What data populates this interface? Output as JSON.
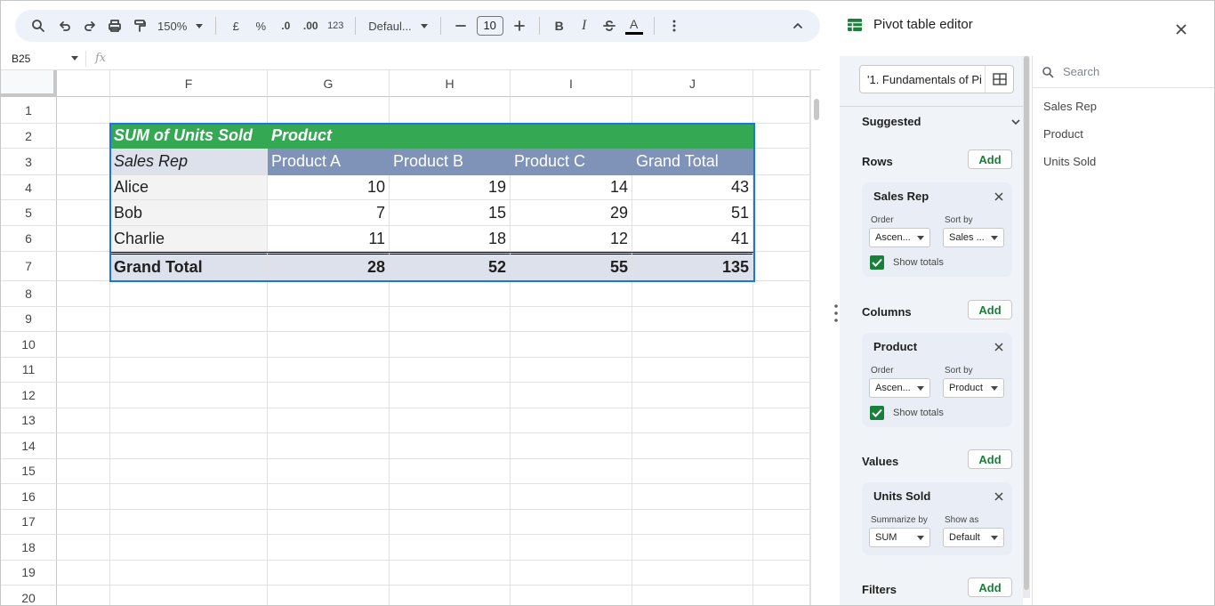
{
  "toolbar": {
    "zoom": "150%",
    "currency": "£",
    "percent": "%",
    "decrease_decimal": ".0",
    "increase_decimal": ".00",
    "number_format": "123",
    "font": "Defaul...",
    "font_size": "10",
    "bold": "B",
    "italic": "I",
    "text_color": "A"
  },
  "formula_bar": {
    "cell_ref": "B25",
    "fx": "fx",
    "value": ""
  },
  "columns": [
    "F",
    "G",
    "H",
    "I",
    "J"
  ],
  "rows": [
    "1",
    "2",
    "3",
    "4",
    "5",
    "6",
    "7",
    "8",
    "9",
    "10",
    "11",
    "12",
    "13",
    "14",
    "15",
    "16",
    "17",
    "18",
    "19",
    "20"
  ],
  "pivot": {
    "corner_label": "SUM of Units Sold",
    "column_group_label": "Product",
    "row_header": "Sales Rep",
    "column_headers": [
      "Product A",
      "Product B",
      "Product C",
      "Grand Total"
    ],
    "rows": [
      {
        "label": "Alice",
        "values": [
          "10",
          "19",
          "14",
          "43"
        ]
      },
      {
        "label": "Bob",
        "values": [
          "7",
          "15",
          "29",
          "51"
        ]
      },
      {
        "label": "Charlie",
        "values": [
          "11",
          "18",
          "12",
          "41"
        ]
      }
    ],
    "grand_total": {
      "label": "Grand Total",
      "values": [
        "28",
        "52",
        "55",
        "135"
      ]
    }
  },
  "editor": {
    "title": "Pivot table editor",
    "range": "'1. Fundamentals of Pi",
    "suggested": "Suggested",
    "add_label": "Add",
    "rows_section": "Rows",
    "columns_section": "Columns",
    "values_section": "Values",
    "filters_section": "Filters",
    "row_card": {
      "title": "Sales Rep",
      "order_label": "Order",
      "order_value": "Ascen...",
      "sort_label": "Sort by",
      "sort_value": "Sales ...",
      "show_totals": "Show totals"
    },
    "column_card": {
      "title": "Product",
      "order_label": "Order",
      "order_value": "Ascen...",
      "sort_label": "Sort by",
      "sort_value": "Product",
      "show_totals": "Show totals"
    },
    "value_card": {
      "title": "Units Sold",
      "summarize_label": "Summarize by",
      "summarize_value": "SUM",
      "show_as_label": "Show as",
      "show_as_value": "Default"
    },
    "search_placeholder": "Search",
    "fields": [
      "Sales Rep",
      "Product",
      "Units Sold"
    ]
  },
  "colors": {
    "header_green": "#34a853",
    "header_blue": "#7f93b8",
    "selection": "#1a73e8",
    "add_green": "#188038"
  }
}
